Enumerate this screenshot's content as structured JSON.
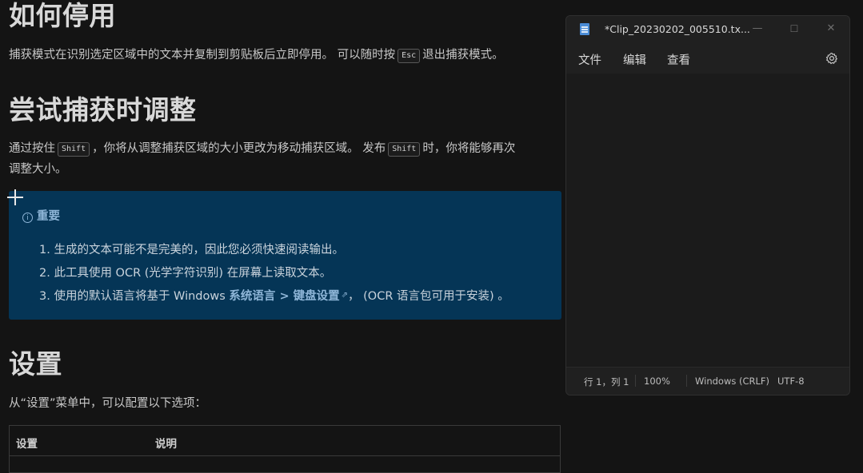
{
  "doc": {
    "h_stop": "如何停用",
    "stop_text_before": "捕获模式在识别选定区域中的文本并复制到剪贴板后立即停用。 可以随时按",
    "stop_key": "Esc",
    "stop_text_after": "退出捕获模式。",
    "h_adjust": "尝试捕获时调整",
    "adjust_before": "通过按住",
    "adjust_key1": "Shift",
    "adjust_mid": "，你将从调整捕获区域的大小更改为移动捕获区域。 发布",
    "adjust_key2": "Shift",
    "adjust_after": "时，你将能够再次",
    "adjust_line2": "调整大小。",
    "alert": {
      "title": "重要",
      "items": [
        "1. 生成的文本可能不是完美的，因此您必须快速阅读输出。",
        "2. 此工具使用 OCR (光学字符识别) 在屏幕上读取文本。"
      ],
      "item3_before": "3. 使用的默认语言将基于 Windows ",
      "item3_link1": "系统语言",
      "item3_sep": " > ",
      "item3_link2": "键盘设置",
      "item3_after": "，  (OCR 语言包可用于安装) 。"
    },
    "h_settings": "设置",
    "settings_intro": "从“设置”菜单中，可以配置以下选项：",
    "table_headers": [
      "设置",
      "说明"
    ]
  },
  "notepad": {
    "title": "*Clip_20230202_005510.tx...",
    "controls": {
      "minimize": "—",
      "maximize": "☐",
      "close": "✕"
    },
    "menu": [
      "文件",
      "编辑",
      "查看"
    ],
    "status": {
      "position": "行 1，列 1",
      "zoom": "100%",
      "line_ending": "Windows (CRLF)",
      "encoding": "UTF-8"
    }
  }
}
